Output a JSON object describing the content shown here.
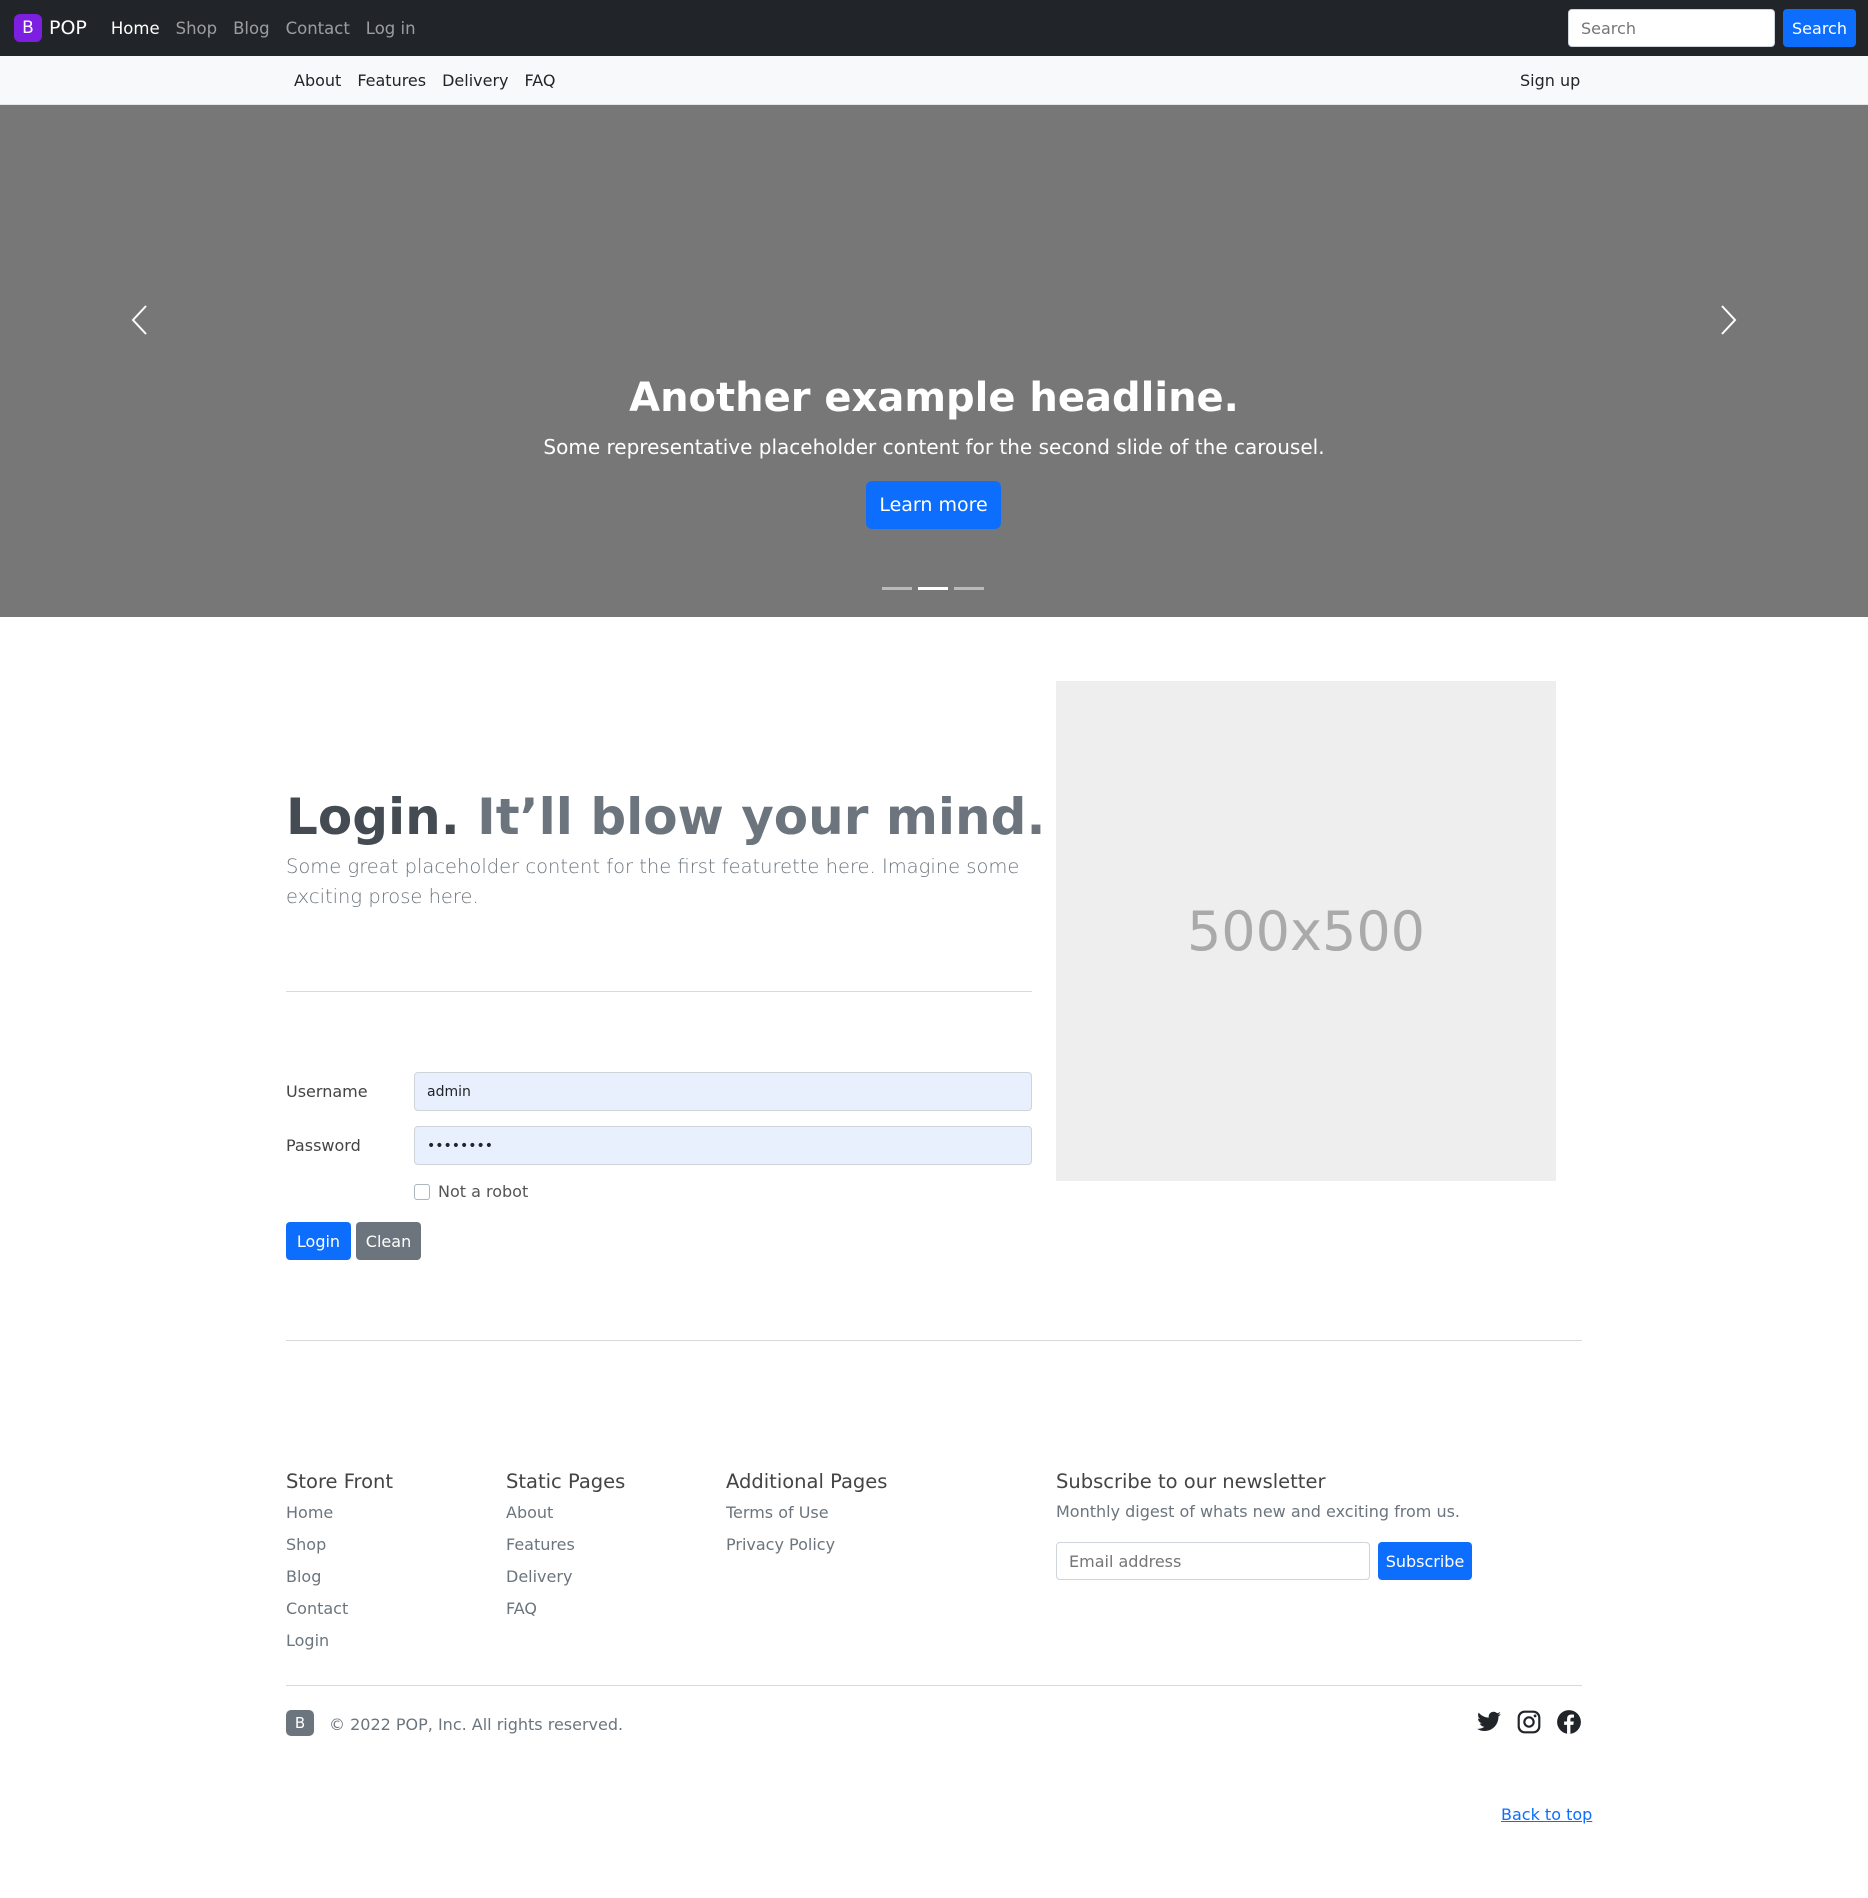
{
  "topnav": {
    "brand_logo": "B",
    "brand_name": "POP",
    "links": [
      "Home",
      "Shop",
      "Blog",
      "Contact",
      "Log in"
    ],
    "search_placeholder": "Search",
    "search_button": "Search"
  },
  "subnav": {
    "links": [
      "About",
      "Features",
      "Delivery",
      "FAQ"
    ],
    "signup": "Sign up"
  },
  "carousel": {
    "headline": "Another example headline.",
    "subtext": "Some representative placeholder content for the second slide of the carousel.",
    "button": "Learn more",
    "active_slide": 2,
    "slide_count": 3
  },
  "featurette": {
    "title": "Login.",
    "title_muted": "It’ll blow your mind.",
    "description": "Some great placeholder content for the first featurette here. Imagine some exciting prose here.",
    "placeholder_text": "500x500"
  },
  "login_form": {
    "username_label": "Username",
    "username_value": "admin",
    "password_label": "Password",
    "password_value": "••••••••",
    "robot_label": "Not a robot",
    "login_button": "Login",
    "clean_button": "Clean"
  },
  "footer": {
    "columns": [
      {
        "title": "Store Front",
        "links": [
          "Home",
          "Shop",
          "Blog",
          "Contact",
          "Login"
        ]
      },
      {
        "title": "Static Pages",
        "links": [
          "About",
          "Features",
          "Delivery",
          "FAQ"
        ]
      },
      {
        "title": "Additional Pages",
        "links": [
          "Terms of Use",
          "Privacy Policy"
        ]
      }
    ],
    "newsletter": {
      "title": "Subscribe to our newsletter",
      "description": "Monthly digest of whats new and exciting from us.",
      "email_placeholder": "Email address",
      "subscribe_button": "Subscribe"
    },
    "logo": "B",
    "copyright": "© 2022 POP, Inc. All rights reserved.",
    "social_icons": [
      "twitter-icon",
      "instagram-icon",
      "facebook-icon"
    ],
    "back_to_top": "Back to top"
  },
  "colors": {
    "primary": "#0d6efd",
    "secondary": "#6c757d",
    "navbar_dark": "#212529",
    "brand": "#7c1fe0",
    "carousel_bg": "#777777"
  }
}
